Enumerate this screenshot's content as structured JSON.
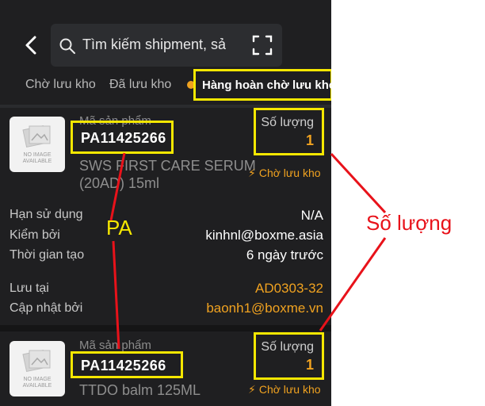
{
  "header": {
    "search_placeholder": "Tìm kiếm shipment, sả"
  },
  "tabs": [
    {
      "label": "Chờ lưu kho"
    },
    {
      "label": "Đã lưu kho"
    },
    {
      "label": "Hàng hoàn chờ lưu kho",
      "active": true
    }
  ],
  "products": [
    {
      "thumb_text": "NO IMAGE AVAILABLE",
      "sku_label": "Mã sản phẩm",
      "sku": "PA11425266",
      "qty_label": "Số lượng",
      "qty": "1",
      "name_line1": "SWS FIRST CARE SERUM",
      "name_line2": "(20AD) 15ml",
      "status": "Chờ lưu kho",
      "details": [
        {
          "label": "Hạn sử dụng",
          "value": "N/A",
          "accent": false
        },
        {
          "label": "Kiểm bởi",
          "value": "kinhnl@boxme.asia",
          "accent": false
        },
        {
          "label": "Thời gian tạo",
          "value": "6 ngày trước",
          "accent": false
        },
        {
          "label": "Lưu tại",
          "value": "AD0303-32",
          "accent": true
        },
        {
          "label": "Cập nhật bởi",
          "value": "baonh1@boxme.vn",
          "accent": true
        }
      ]
    },
    {
      "thumb_text": "NO IMAGE AVAILABLE",
      "sku_label": "Mã sản phẩm",
      "sku": "PA11425266",
      "qty_label": "Số lượng",
      "qty": "1",
      "name_line1": "TTDO balm 125ML",
      "status": "Chờ lưu kho"
    }
  ],
  "annotations": {
    "pa": "PA",
    "quantity": "Số lượng"
  },
  "colors": {
    "background": "#1f1f21",
    "accent": "#f0a220",
    "highlight_box": "#f5e700",
    "annotation_red": "#e8121a"
  },
  "icons": [
    "back-arrow-icon",
    "search-icon",
    "scan-icon",
    "bolt-icon",
    "no-image-icon"
  ]
}
